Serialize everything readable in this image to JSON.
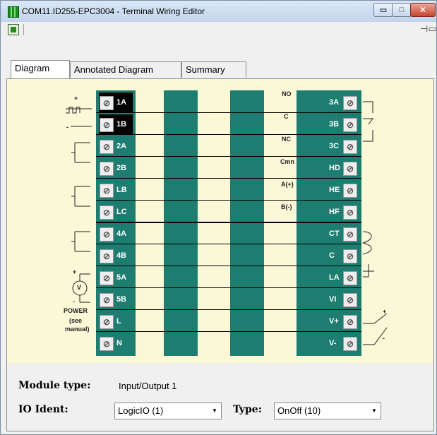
{
  "window": {
    "title": "COM11.ID255-EPC3004 - Terminal Wiring Editor",
    "minimize_symbol": "▭",
    "maximize_symbol": "□",
    "close_symbol": "✕"
  },
  "tabs": [
    {
      "label": "Diagram",
      "active": true
    },
    {
      "label": "Annotated Diagram",
      "active": false
    },
    {
      "label": "Summary",
      "active": false
    }
  ],
  "left_terminals": [
    "1A",
    "1B",
    "2A",
    "2B",
    "LB",
    "LC",
    "4A",
    "4B",
    "5A",
    "5B",
    "L",
    "N"
  ],
  "right_terminals": [
    "3A",
    "3B",
    "3C",
    "HD",
    "HE",
    "HF",
    "CT",
    "C",
    "LA",
    "VI",
    "V+",
    "V-"
  ],
  "right_wire_labels": {
    "no": "NO",
    "c": "C",
    "nc": "NC",
    "cmn": "Cmn",
    "a_plus": "A(+)",
    "b_minus": "B(-)"
  },
  "left_wire_labels": {
    "power": "POWER",
    "see": "(see",
    "manual": "manual)",
    "volt": "V",
    "plus": "+",
    "minus": "-"
  },
  "module": {
    "type_label": "Module type:",
    "type_value": "Input/Output 1"
  },
  "io_ident": {
    "label": "IO Ident:",
    "value": "LogicIO (1)"
  },
  "type": {
    "label": "Type:",
    "value": "OnOff (10)"
  },
  "colors": {
    "teal": "#1d7d70",
    "cream": "#fbf8d8",
    "terminal_text": "#ffffff"
  }
}
